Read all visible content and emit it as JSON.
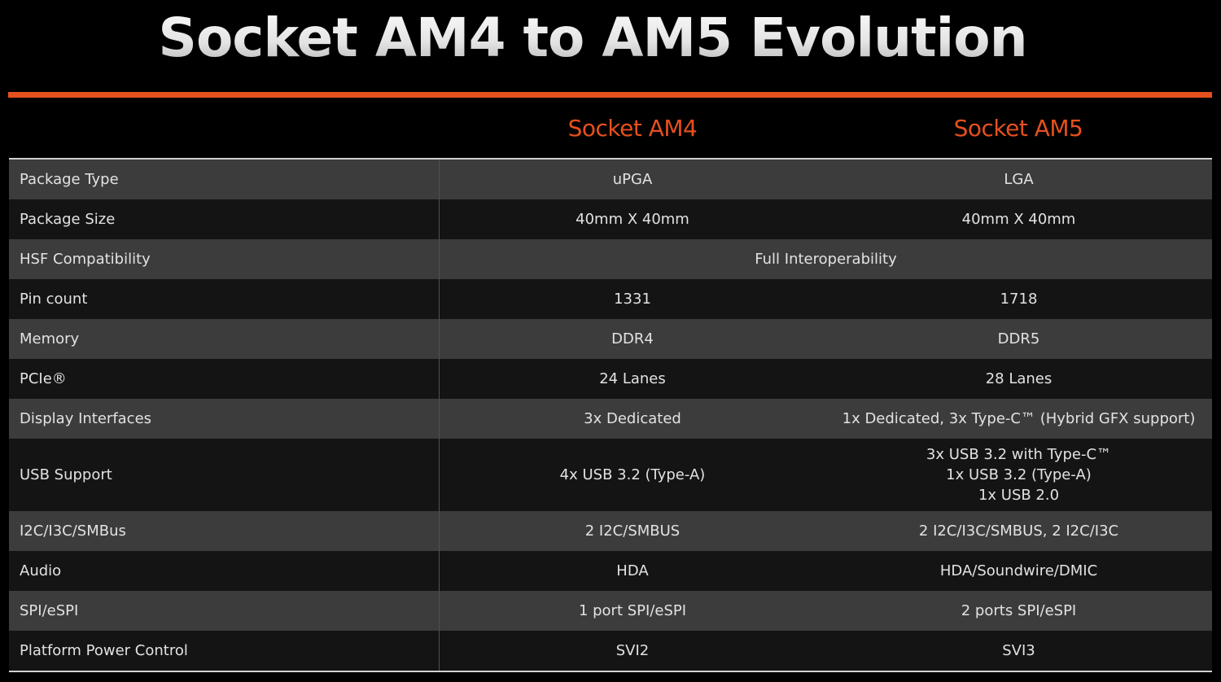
{
  "title": "Socket AM4 to AM5 Evolution",
  "colors": {
    "accent": "#e5501d",
    "row_light": "#3c3c3c",
    "row_dark": "#141414",
    "background": "#000000"
  },
  "table": {
    "columns": [
      "",
      "Socket AM4",
      "Socket AM5"
    ],
    "rows": [
      {
        "label": "Package Type",
        "am4": "uPGA",
        "am5": "LGA"
      },
      {
        "label": "Package Size",
        "am4": "40mm X 40mm",
        "am5": "40mm X 40mm"
      },
      {
        "label": "HSF Compatibility",
        "shared": "Full Interoperability"
      },
      {
        "label": "Pin count",
        "am4": "1331",
        "am5": "1718"
      },
      {
        "label": "Memory",
        "am4": "DDR4",
        "am5": "DDR5"
      },
      {
        "label": "PCIe®",
        "am4": "24 Lanes",
        "am5": "28 Lanes"
      },
      {
        "label": "Display Interfaces",
        "am4": "3x Dedicated",
        "am5": "1x Dedicated, 3x Type-C™ (Hybrid GFX support)"
      },
      {
        "label": "USB Support",
        "am4": "4x USB 3.2 (Type-A)",
        "am5_lines": [
          "3x USB 3.2 with Type-C™",
          "1x USB 3.2 (Type-A)",
          "1x USB 2.0"
        ]
      },
      {
        "label": "I2C/I3C/SMBus",
        "am4": "2 I2C/SMBUS",
        "am5": "2 I2C/I3C/SMBUS, 2 I2C/I3C"
      },
      {
        "label": "Audio",
        "am4": "HDA",
        "am5": "HDA/Soundwire/DMIC"
      },
      {
        "label": "SPI/eSPI",
        "am4": "1 port SPI/eSPI",
        "am5": "2 ports SPI/eSPI"
      },
      {
        "label": "Platform Power Control",
        "am4": "SVI2",
        "am5": "SVI3"
      }
    ]
  }
}
